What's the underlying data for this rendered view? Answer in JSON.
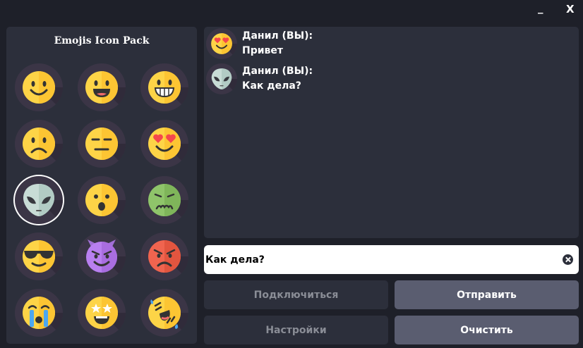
{
  "window": {
    "minimize_label": "_",
    "close_label": "X"
  },
  "emoji_pack": {
    "title": "Emojis Icon Pack",
    "icons": [
      "smile-emoji-icon",
      "grin-emoji-icon",
      "grimace-emoji-icon",
      "frown-emoji-icon",
      "neutral-emoji-icon",
      "heart-eyes-emoji-icon",
      "alien-emoji-icon",
      "shocked-emoji-icon",
      "nauseated-emoji-icon",
      "sunglasses-emoji-icon",
      "devil-emoji-icon",
      "angry-emoji-icon",
      "crying-emoji-icon",
      "star-struck-emoji-icon",
      "rofl-emoji-icon"
    ],
    "selected_index": 6
  },
  "messages": [
    {
      "author": "Данил (ВЫ):",
      "text": "Привет",
      "avatar_icon": "heart-eyes-emoji-icon"
    },
    {
      "author": "Данил (ВЫ):",
      "text": "Как дела?",
      "avatar_icon": "alien-emoji-icon"
    }
  ],
  "input": {
    "value": "Как дела?",
    "placeholder": ""
  },
  "buttons": {
    "connect": "Подключиться",
    "send": "Отправить",
    "settings": "Настройки",
    "clear": "Очистить"
  },
  "colors": {
    "background": "#1e2029",
    "panel": "#2c2f3b",
    "emoji_tile": "#3b3546",
    "button_active": "#5a5d70",
    "button_inactive_text": "#8a8d96",
    "emoji_yellow": "#fdd447"
  }
}
